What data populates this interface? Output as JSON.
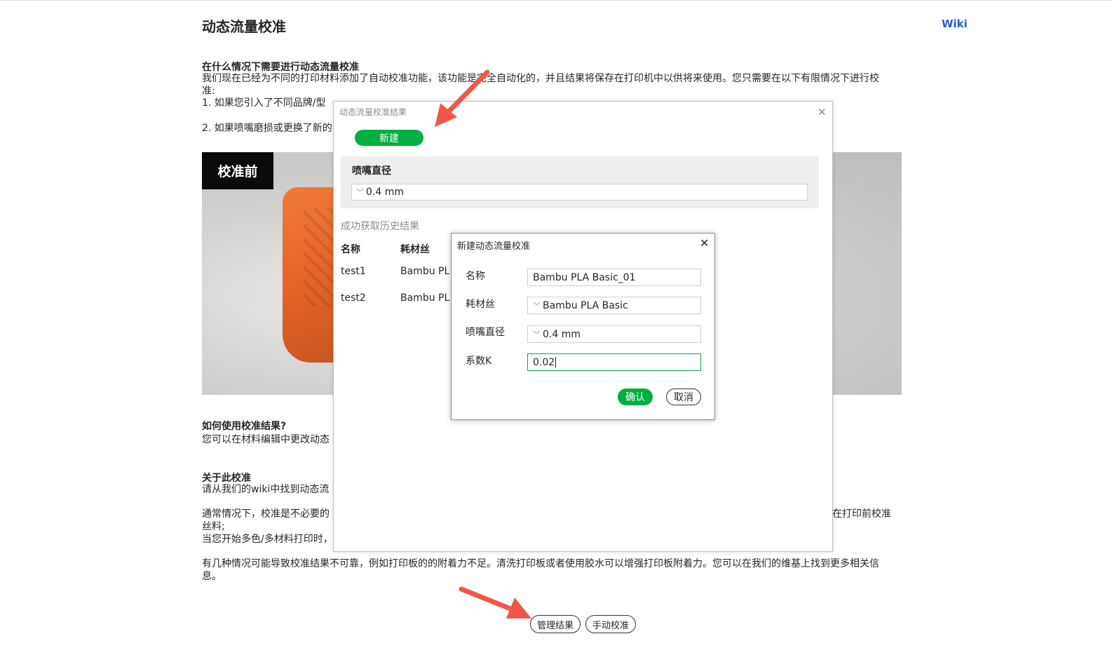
{
  "page": {
    "title": "动态流量校准",
    "wiki_link": "Wiki",
    "section_when": {
      "heading": "在什么情况下需要进行动态流量校准",
      "text": "我们现在已经为不同的打印材料添加了自动校准功能，该功能是完全自动化的，并且结果将保存在打印机中以供将来使用。您只需要在以下有限情况下进行校\n准:\n1. 如果您引入了不同品牌/型",
      "text_line2": "2. 如果喷嘴磨损或更换了新的"
    },
    "photo_label": "校准前",
    "section_how": {
      "heading": "如何使用校准结果?",
      "text": "您可以在材料编辑中更改动态"
    },
    "section_about": {
      "heading": "关于此校准",
      "text": "请从我们的wiki中找到动态流",
      "text2": "通常情况下，校准是不必要的",
      "text2_right": "在打印前校准",
      "text2_cont": "丝料;",
      "text3": "当您开始多色/多材料打印时，",
      "text4": "有几种情况可能导致校准结果不可靠，例如打印板的的附着力不足。清洗打印板或者使用胶水可以增强打印板附着力。您可以在我们的维基上找到更多相关信\n息。"
    },
    "buttons": {
      "manage_results": "管理结果",
      "manual_calibration": "手动校准"
    },
    "colors": {
      "accent_green": "#00ae42",
      "annotation_arrow": "#f0574a",
      "wiki_blue": "#1e5fc9"
    }
  },
  "results_dialog": {
    "title": "动态流量校准结果",
    "new_button": "新建",
    "nozzle_label": "喷嘴直径",
    "nozzle_value": "0.4 mm",
    "history_status": "成功获取历史结果",
    "columns": [
      "名称",
      "耗材丝"
    ],
    "rows": [
      {
        "name": "test1",
        "filament": "Bambu PL"
      },
      {
        "name": "test2",
        "filament": "Bambu PL"
      }
    ]
  },
  "new_dialog": {
    "title": "新建动态流量校准",
    "fields": [
      {
        "label": "名称",
        "value": "Bambu PLA Basic_01"
      },
      {
        "label": "耗材丝",
        "value": "Bambu PLA Basic"
      },
      {
        "label": "喷嘴直径",
        "value": "0.4 mm"
      },
      {
        "label": "系数K",
        "value": "0.02"
      }
    ],
    "confirm": "确认",
    "cancel": "取消"
  }
}
